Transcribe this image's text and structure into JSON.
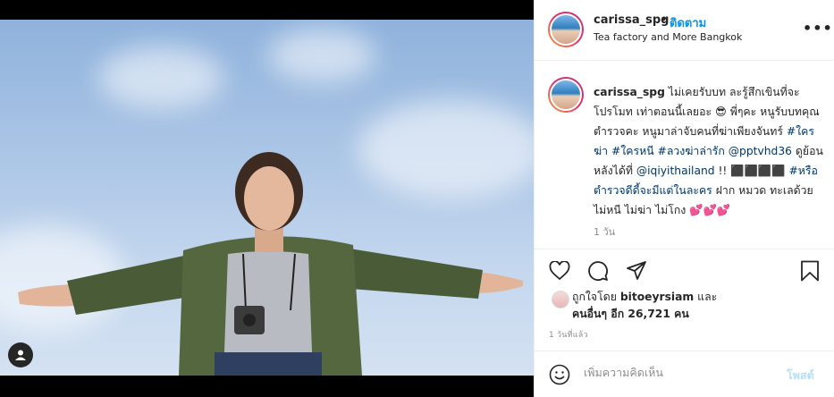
{
  "post": {
    "username": "carissa_spg",
    "follow_label": "ติดตาม",
    "dot": "•",
    "location": "Tea factory and More Bangkok",
    "more": "•••",
    "caption": {
      "username": "carissa_spg",
      "part1": " ไม่เคยรับบท ละรู้สึกเขินที่จะโปรโมท เท่าตอนนี้เลยอะ 😎 พี่ๆคะ หนูรับบทคุณตำรวจคะ หนูมาล่าจับคนที่ฆ่าเพียงจันทร์ ",
      "tag1": "#ใครฆ่า",
      "tag2": "#ใครหนี",
      "tag3": "#ลวงฆ่าล่ารัก",
      "mention1": "@pptvhd36",
      "part2": " ดูย้อนหลังได้ที่ ",
      "mention2": "@iqiyithailand",
      "part3": " !! ⬛⬛⬛⬛ ",
      "tag4": "#หรือตำรวจดีดี้จะมีแต่ในละคร",
      "part4": " ฝาก หมวด ทะเลด้วย ไม่หนี ไม่ฆ่า ไม่โกง 💕💕💕"
    },
    "caption_time": "1 วัน",
    "likes": {
      "prefix": "ถูกใจโดย ",
      "liker": "bitoeyrsiam",
      "mid": " และ",
      "others": "คนอื่นๆ อีก 26,721 คน"
    },
    "post_time": "1 วันที่แล้ว",
    "comment_placeholder": "เพิ่มความคิดเห็น",
    "post_button": "โพสต์"
  },
  "icons": {
    "like": "heart-icon",
    "comment": "comment-icon",
    "share": "share-icon",
    "save": "bookmark-icon",
    "emoji": "emoji-icon",
    "tag": "user-tag-icon"
  },
  "colors": {
    "accent": "#0095f6",
    "text": "#262626",
    "muted": "#8e8e8e",
    "hashtag": "#00376b",
    "post_disabled": "#b2dffc"
  }
}
